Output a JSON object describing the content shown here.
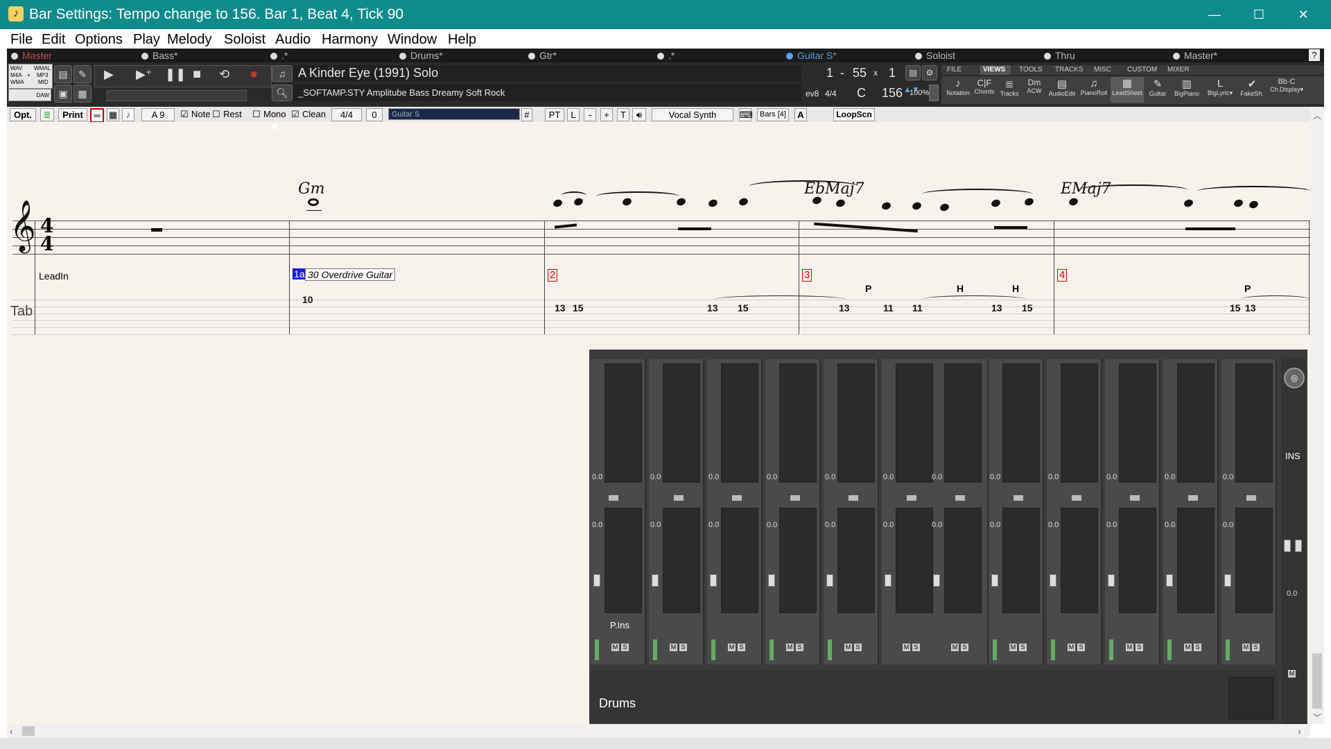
{
  "window": {
    "title": "Bar Settings: Tempo change to 156.   Bar 1, Beat 4, Tick 90",
    "minimize": "—",
    "maximize": "☐",
    "close": "✕"
  },
  "menu": [
    "File",
    "Edit",
    "Options",
    "Play",
    "Melody",
    "Soloist",
    "Audio",
    "Harmony",
    "Window",
    "Help"
  ],
  "tracks": [
    {
      "label": "Master",
      "color": "#c0504d"
    },
    {
      "label": "Bass*"
    },
    {
      "label": ".*"
    },
    {
      "label": "Drums*"
    },
    {
      "label": "Gtr*"
    },
    {
      "label": ".*"
    },
    {
      "label": "Guitar S*",
      "color": "#5aa0e0"
    },
    {
      "label": "Soloist"
    },
    {
      "label": "Thru"
    },
    {
      "label": "Master*"
    },
    {
      "label": "?"
    }
  ],
  "formats": {
    "wav": "WAV",
    "wma": "WMAL",
    "m4a": "M4A",
    "plus": "+",
    "mp3": "MP3",
    "wma2": "WMA",
    "mid": "MID",
    "daw": "DAW"
  },
  "song": {
    "title": "A Kinder Eye (1991) Solo",
    "style": "_SOFTAMP.STY Amplitube Bass Dreamy Soft Rock",
    "loop_start": "1",
    "loop_dash": "-",
    "loop_end": "55",
    "loop_x": "x",
    "loop_count": "1",
    "ev": "ev8",
    "time_sig": "4/4",
    "key": "C",
    "tempo": "156",
    "tempo_pct": "100%"
  },
  "tabs": [
    "FILE",
    "VIEWS",
    "TOOLS",
    "TRACKS",
    "MISC",
    "CUSTOM",
    "MIXER"
  ],
  "tools": [
    "Notation",
    "Chords",
    "Tracks",
    "ACW",
    "AudioEdit",
    "PianoRoll",
    "LeadSheet",
    "Guitar",
    "BigPiano",
    "BigLyric▾",
    "FakeSh.",
    "Ch.Display▾"
  ],
  "tool_icons": [
    "♪",
    "C|F",
    "≣",
    "Dm",
    "▤",
    "♫",
    "▦",
    "✎",
    "▥",
    "L",
    "✔",
    "Bb·C"
  ],
  "notebar": {
    "opt": "Opt.",
    "print": "Print",
    "voice": "A 9",
    "note": "Note",
    "rest": "Rest",
    "mono": "Mono",
    "clean": "Clean",
    "ts": "4/4",
    "zero": "0",
    "track_field": "Guitar S",
    "sharp": "#",
    "pt": "PT",
    "l": "L",
    "minus": "-",
    "plus": "+",
    "t": "T",
    "vocal": "Vocal Synth",
    "bars": "Bars [4]",
    "loopscn": "LoopScn"
  },
  "notation": {
    "time_sig_top": "4",
    "time_sig_bottom": "4",
    "leadin": "LeadIn",
    "tab_label": "Tab",
    "patch_num": "1a",
    "patch": "30 Overdrive Guitar",
    "bar_numbers": [
      "2",
      "3",
      "4"
    ],
    "chords": [
      "Gm",
      "EbMaj7",
      "EMaj7"
    ],
    "techniques": [
      "P",
      "H",
      "H",
      "P"
    ],
    "tab_numbers": [
      "10",
      "13",
      "15",
      "13",
      "15",
      "13",
      "11",
      "11",
      "13",
      "15",
      "15",
      "13"
    ]
  },
  "mixer": {
    "value": "0.0",
    "pins": "P.Ins",
    "ins": "INS",
    "drums": "Drums",
    "m": "M",
    "s": "S"
  }
}
